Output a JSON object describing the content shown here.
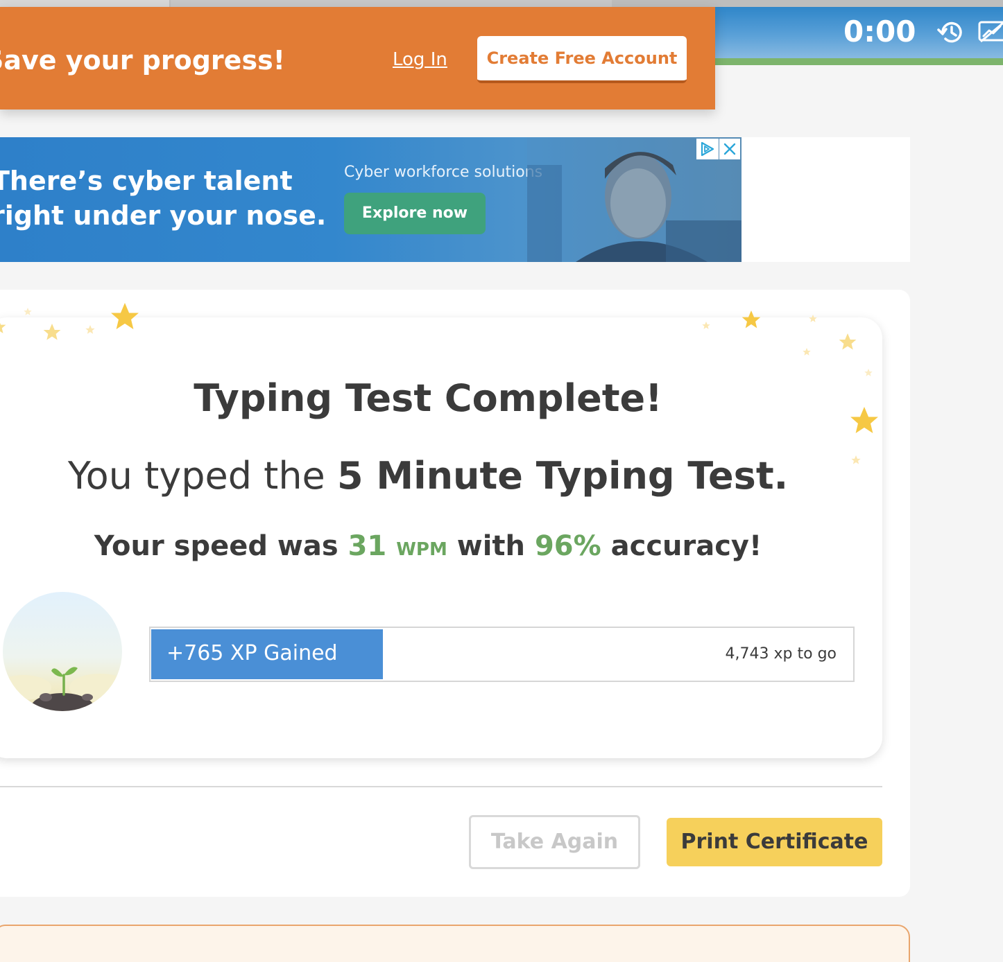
{
  "header": {
    "timer": "0:00",
    "icons": [
      "history-icon",
      "chart-icon"
    ]
  },
  "save_banner": {
    "text": "Save your progress!",
    "login_label": "Log In",
    "create_account_label": "Create Free Account"
  },
  "ad": {
    "headline_line1": "There’s cyber talent",
    "headline_line2": "right under your nose.",
    "subtext": "Cyber workforce solutions",
    "cta_label": "Explore now",
    "icons": [
      "ad-choices-icon",
      "ad-close-icon"
    ]
  },
  "results": {
    "title": "Typing Test Complete!",
    "typed_prefix": "You typed the ",
    "test_name": "5 Minute Typing Test.",
    "speed_prefix": "Your speed was ",
    "speed_value": "31",
    "speed_unit": "WPM",
    "with_text": " with ",
    "accuracy_value": "96%",
    "accuracy_suffix": " accuracy!",
    "xp_gained_label": "+765 XP Gained",
    "xp_to_go_label": "4,743 xp to go",
    "xp_progress_fraction": 0.33
  },
  "actions": {
    "take_again_label": "Take Again",
    "print_certificate_label": "Print Certificate"
  },
  "colors": {
    "banner_orange": "#e27c35",
    "accent_green": "#6ba660",
    "xp_blue": "#4a8fd6",
    "certificate_yellow": "#f6d05b"
  }
}
